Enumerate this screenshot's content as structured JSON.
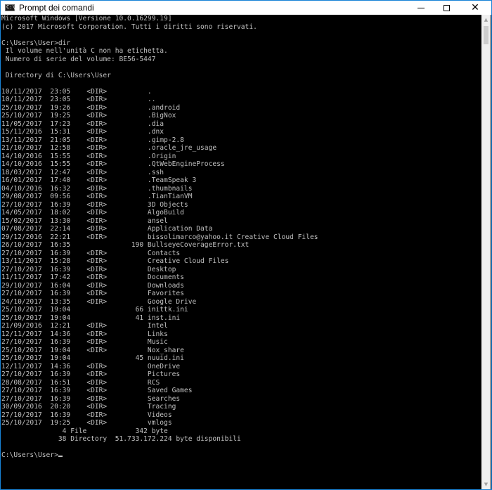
{
  "window": {
    "title": "Prompt dei comandi",
    "icon_label": "C:\\",
    "minimize_label": "—",
    "maximize_label": "☐",
    "close_label": "✕"
  },
  "console": {
    "lines": [
      "Microsoft Windows [Versione 10.0.16299.19]",
      "(c) 2017 Microsoft Corporation. Tutti i diritti sono riservati.",
      "",
      "C:\\Users\\User>dir",
      " Il volume nell'unità C non ha etichetta.",
      " Numero di serie del volume: BE56-5447",
      "",
      " Directory di C:\\Users\\User",
      "",
      "10/11/2017  23:05    <DIR>          .",
      "10/11/2017  23:05    <DIR>          ..",
      "25/10/2017  19:26    <DIR>          .android",
      "25/10/2017  19:25    <DIR>          .BigNox",
      "11/05/2017  17:23    <DIR>          .dia",
      "15/11/2016  15:31    <DIR>          .dnx",
      "13/11/2017  21:05    <DIR>          .gimp-2.8",
      "21/10/2017  12:58    <DIR>          .oracle_jre_usage",
      "14/10/2016  15:55    <DIR>          .Origin",
      "14/10/2016  15:55    <DIR>          .QtWebEngineProcess",
      "18/03/2017  12:47    <DIR>          .ssh",
      "16/01/2017  17:40    <DIR>          .TeamSpeak 3",
      "04/10/2016  16:32    <DIR>          .thumbnails",
      "29/08/2017  09:56    <DIR>          .TianTianVM",
      "27/10/2017  16:39    <DIR>          3D Objects",
      "14/05/2017  18:02    <DIR>          AlgoBuild",
      "15/02/2017  13:30    <DIR>          ansel",
      "07/08/2017  22:14    <DIR>          Application Data",
      "29/12/2016  22:21    <DIR>          bissolimarco@yahoo.it Creative Cloud Files",
      "26/10/2017  16:35               190 BullseyeCoverageError.txt",
      "27/10/2017  16:39    <DIR>          Contacts",
      "13/11/2017  15:28    <DIR>          Creative Cloud Files",
      "27/10/2017  16:39    <DIR>          Desktop",
      "11/11/2017  17:42    <DIR>          Documents",
      "29/10/2017  16:04    <DIR>          Downloads",
      "27/10/2017  16:39    <DIR>          Favorites",
      "24/10/2017  13:35    <DIR>          Google Drive",
      "25/10/2017  19:04                66 inittk.ini",
      "25/10/2017  19:04                41 inst.ini",
      "21/09/2016  12:21    <DIR>          Intel",
      "12/11/2017  14:36    <DIR>          Links",
      "27/10/2017  16:39    <DIR>          Music",
      "25/10/2017  19:04    <DIR>          Nox_share",
      "25/10/2017  19:04                45 nuuid.ini",
      "12/11/2017  14:36    <DIR>          OneDrive",
      "27/10/2017  16:39    <DIR>          Pictures",
      "28/08/2017  16:51    <DIR>          RCS",
      "27/10/2017  16:39    <DIR>          Saved Games",
      "27/10/2017  16:39    <DIR>          Searches",
      "30/09/2016  20:20    <DIR>          Tracing",
      "27/10/2017  16:39    <DIR>          Videos",
      "25/10/2017  19:25    <DIR>          vmlogs",
      "               4 File            342 byte",
      "              38 Directory  51.733.172.224 byte disponibili",
      "",
      "C:\\Users\\User>"
    ]
  },
  "colors": {
    "titlebar_bg": "#ffffff",
    "console_bg": "#000000",
    "console_fg": "#c0c0c0",
    "border": "#1883d7"
  }
}
